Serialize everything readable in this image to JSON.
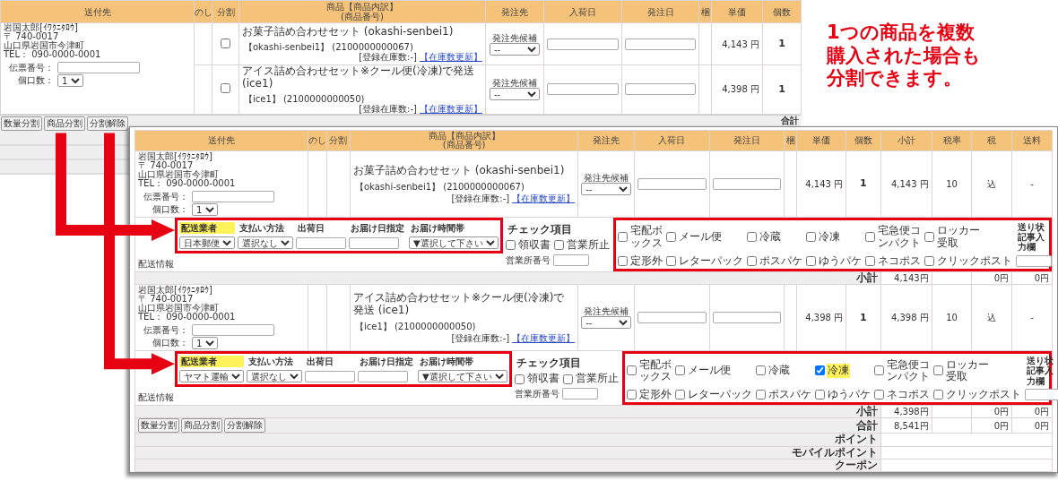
{
  "background_screen": {
    "columns": [
      {
        "label": "送付先"
      },
      {
        "label": "のし"
      },
      {
        "label": "分割"
      },
      {
        "label": "商品【商品内訳】",
        "sub": "(商品番号)"
      },
      {
        "label": "発注先"
      },
      {
        "label": "入荷日"
      },
      {
        "label": "発注日"
      },
      {
        "label": "梱"
      },
      {
        "label": "単価"
      },
      {
        "label": "個数"
      }
    ],
    "recipient": {
      "name": "岩国太郎[ｲﾜｸﾆﾀﾛｳ]",
      "postal": "〒 740-0017",
      "address": "山口県岩国市今津町",
      "tel": "TEL： 090-0000-0001",
      "slip_label": "伝票番号：",
      "pieces_label": "個口数：",
      "pieces": "1"
    },
    "items": [
      {
        "title": "お菓子詰め合わせセット (okashi-senbei1)",
        "code": "【okashi-senbei1】 (2100000000067)",
        "stock": "[登録在庫数:-]",
        "stock_link": "【在庫数更新】",
        "supplier_label": "発注先候補",
        "supplier": "--",
        "unit_price": "4,143 円",
        "quantity": "1",
        "split": false
      },
      {
        "title": "アイス詰め合わせセット※クール便(冷凍)で発送 (ice1)",
        "code": "【ice1】 (2100000000050)",
        "stock": "[登録在庫数:-]",
        "stock_link": "【在庫数更新】",
        "supplier_label": "発注先候補",
        "supplier": "--",
        "unit_price": "4,398 円",
        "quantity": "1",
        "split": false
      }
    ],
    "buttons": [
      "数量分割",
      "商品分割",
      "分割解除"
    ],
    "total_label": "合計"
  },
  "caption": [
    "1つの商品を複数",
    "購入された場合も",
    "分割できます。"
  ],
  "foreground_screen": {
    "columns": [
      {
        "label": "送付先"
      },
      {
        "label": "のし"
      },
      {
        "label": "分割"
      },
      {
        "label": "商品【商品内訳】",
        "sub": "(商品番号)"
      },
      {
        "label": "発注先"
      },
      {
        "label": "入荷日"
      },
      {
        "label": "発注日"
      },
      {
        "label": "梱"
      },
      {
        "label": "単価"
      },
      {
        "label": "個数"
      },
      {
        "label": "小計"
      },
      {
        "label": "税率"
      },
      {
        "label": "税"
      },
      {
        "label": "送料"
      }
    ],
    "orders": [
      {
        "recipient": {
          "name": "岩国太郎[ｲﾜｸﾆﾀﾛｳ]",
          "postal": "〒 740-0017",
          "address": "山口県岩国市今津町",
          "tel": "TEL： 090-0000-0001",
          "slip_label": "伝票番号：",
          "pieces_label": "個口数：",
          "pieces": "1"
        },
        "item": {
          "title": "お菓子詰め合わせセット (okashi-senbei1)",
          "code": "【okashi-senbei1】 (2100000000067)",
          "stock": "[登録在庫数:-]",
          "stock_link": "【在庫数更新】",
          "supplier_label": "発注先候補",
          "supplier": "--",
          "unit_price": "4,143 円",
          "quantity": "1",
          "subtotal": "4,143 円",
          "tax_rate": "10",
          "tax": "込",
          "shipping": "-"
        },
        "shipping": {
          "label": "配送情報",
          "fields": [
            {
              "label": "配送業者",
              "highlighted": true,
              "kind": "select",
              "value": "日本郵便"
            },
            {
              "label": "支払い方法",
              "highlighted": false,
              "kind": "select",
              "value": "選択なし"
            },
            {
              "label": "出荷日",
              "highlighted": false,
              "kind": "input"
            },
            {
              "label": "お届け日指定",
              "highlighted": false,
              "kind": "input"
            },
            {
              "label": "お届け時間帯",
              "highlighted": false,
              "kind": "select",
              "value": "▼選択して下さい"
            }
          ],
          "check_label": "チェック項目",
          "checks": [
            {
              "label": "領収書",
              "checked": false
            },
            {
              "label": "営業所止",
              "checked": false
            }
          ],
          "office_label": "営業所番号",
          "options": [
            {
              "label": "宅配ボックス",
              "checked": false,
              "highlighted": false
            },
            {
              "label": "メール便",
              "checked": false,
              "highlighted": false
            },
            {
              "label": "冷蔵",
              "checked": false,
              "highlighted": false
            },
            {
              "label": "冷凍",
              "checked": false,
              "highlighted": false
            },
            {
              "label": "宅急便コンパクト",
              "checked": false,
              "highlighted": false
            },
            {
              "label": "ロッカー受取",
              "checked": false,
              "highlighted": false
            },
            {
              "label": "定形外",
              "checked": false,
              "highlighted": false
            },
            {
              "label": "レターパック",
              "checked": false,
              "highlighted": false
            },
            {
              "label": "ポスパケ",
              "checked": false,
              "highlighted": false
            },
            {
              "label": "ゆうパケ",
              "checked": false,
              "highlighted": false
            },
            {
              "label": "ネコポス",
              "checked": false,
              "highlighted": false
            },
            {
              "label": "クリックポスト",
              "checked": false,
              "highlighted": false
            }
          ],
          "note_label": "送り状記事入力欄"
        },
        "subtotal": {
          "label": "小計",
          "subtotal": "4,143円",
          "tax": "0円",
          "shipping": "0円"
        }
      },
      {
        "recipient": {
          "name": "岩国太郎[ｲﾜｸﾆﾀﾛｳ]",
          "postal": "〒 740-0017",
          "address": "山口県岩国市今津町",
          "tel": "TEL： 090-0000-0001",
          "slip_label": "伝票番号：",
          "pieces_label": "個口数：",
          "pieces": "1"
        },
        "item": {
          "title": "アイス詰め合わせセット※クール便(冷凍)で発送 (ice1)",
          "code": "【ice1】 (2100000000050)",
          "stock": "[登録在庫数:-]",
          "stock_link": "【在庫数更新】",
          "supplier_label": "発注先候補",
          "supplier": "--",
          "unit_price": "4,398 円",
          "quantity": "1",
          "subtotal": "4,398 円",
          "tax_rate": "10",
          "tax": "込",
          "shipping": "-"
        },
        "shipping": {
          "label": "配送情報",
          "fields": [
            {
              "label": "配送業者",
              "highlighted": true,
              "kind": "select",
              "value": "ヤマト運輸"
            },
            {
              "label": "支払い方法",
              "highlighted": false,
              "kind": "select",
              "value": "選択なし"
            },
            {
              "label": "出荷日",
              "highlighted": false,
              "kind": "input"
            },
            {
              "label": "お届け日指定",
              "highlighted": false,
              "kind": "input"
            },
            {
              "label": "お届け時間帯",
              "highlighted": false,
              "kind": "select",
              "value": "▼選択して下さい"
            }
          ],
          "check_label": "チェック項目",
          "checks": [
            {
              "label": "領収書",
              "checked": false
            },
            {
              "label": "営業所止",
              "checked": false
            }
          ],
          "office_label": "営業所番号",
          "options": [
            {
              "label": "宅配ボックス",
              "checked": false,
              "highlighted": false
            },
            {
              "label": "メール便",
              "checked": false,
              "highlighted": false
            },
            {
              "label": "冷蔵",
              "checked": false,
              "highlighted": false
            },
            {
              "label": "冷凍",
              "checked": true,
              "highlighted": true
            },
            {
              "label": "宅急便コンパクト",
              "checked": false,
              "highlighted": false
            },
            {
              "label": "ロッカー受取",
              "checked": false,
              "highlighted": false
            },
            {
              "label": "定形外",
              "checked": false,
              "highlighted": false
            },
            {
              "label": "レターパック",
              "checked": false,
              "highlighted": false
            },
            {
              "label": "ポスパケ",
              "checked": false,
              "highlighted": false
            },
            {
              "label": "ゆうパケ",
              "checked": false,
              "highlighted": false
            },
            {
              "label": "ネコポス",
              "checked": false,
              "highlighted": false
            },
            {
              "label": "クリックポスト",
              "checked": false,
              "highlighted": false
            }
          ],
          "note_label": "送り状記事入力欄"
        },
        "subtotal": {
          "label": "小計",
          "subtotal": "4,398円",
          "tax": "0円",
          "shipping": "0円"
        }
      }
    ],
    "buttons": [
      "数量分割",
      "商品分割",
      "分割解除"
    ],
    "totals": [
      {
        "label": "合計",
        "subtotal": "8,541円",
        "tax": "0円",
        "shipping": "0円"
      },
      {
        "label": "ポイント"
      },
      {
        "label": "モバイルポイント"
      },
      {
        "label": "クーポン"
      }
    ]
  }
}
